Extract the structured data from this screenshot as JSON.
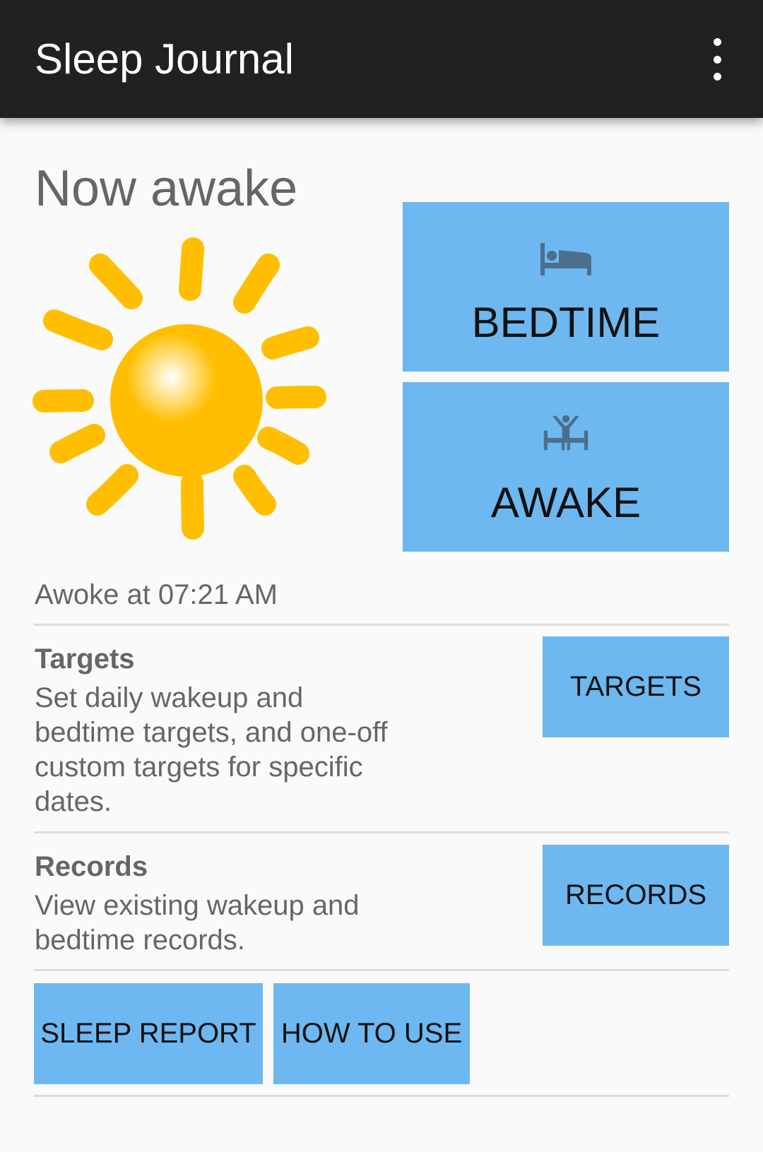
{
  "appbar": {
    "title": "Sleep Journal"
  },
  "status": {
    "state_title": "Now awake",
    "awoke_text": "Awoke at 07:21 AM"
  },
  "actions": {
    "bedtime_label": "BEDTIME",
    "awake_label": "AWAKE"
  },
  "targets": {
    "heading": "Targets",
    "description": "Set daily wakeup and bedtime targets, and one-off custom targets for specific dates.",
    "button_label": "TARGETS"
  },
  "records": {
    "heading": "Records",
    "description": "View existing wakeup and bedtime records.",
    "button_label": "RECORDS"
  },
  "bottom": {
    "sleep_report_label": "SLEEP REPORT",
    "how_to_use_label": "HOW TO USE"
  },
  "icons": {
    "overflow": "more-vert-icon",
    "bedtime": "bed-icon",
    "awake": "wake-up-icon",
    "state": "sun-icon"
  },
  "colors": {
    "appbar": "#212121",
    "button": "#6db8f0",
    "sun": "#ffbf00",
    "text": "#666666"
  }
}
